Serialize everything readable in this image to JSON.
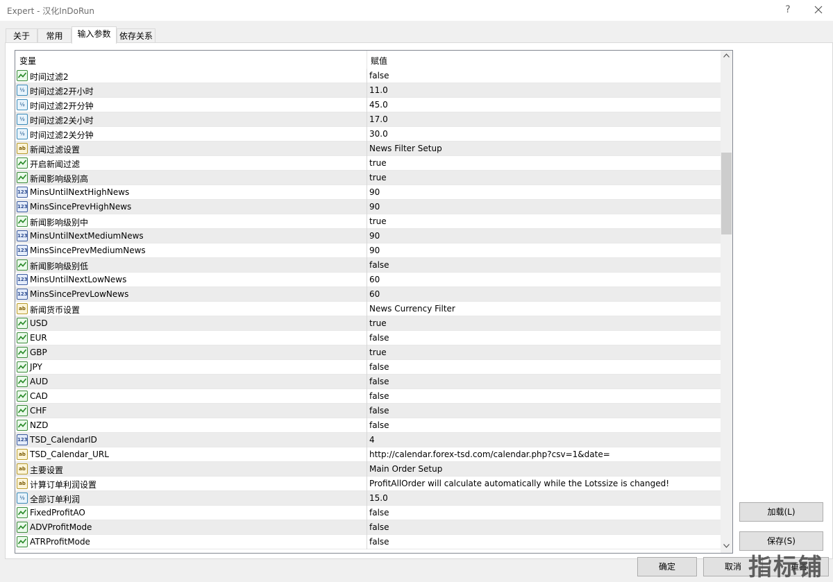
{
  "window": {
    "title": "Expert - 汉化InDoRun",
    "help_label": "?"
  },
  "tabs": [
    {
      "label": "关于"
    },
    {
      "label": "常用"
    },
    {
      "label": "输入参数"
    },
    {
      "label": "依存关系"
    }
  ],
  "grid": {
    "col_variable": "变量",
    "col_value": "赋值",
    "rows": [
      {
        "name": "时间过滤2",
        "value": "false",
        "type": "bool"
      },
      {
        "name": "时间过滤2开小时",
        "value": "11.0",
        "type": "dbl"
      },
      {
        "name": "时间过滤2开分钟",
        "value": "45.0",
        "type": "dbl"
      },
      {
        "name": "时间过滤2关小时",
        "value": "17.0",
        "type": "dbl"
      },
      {
        "name": "时间过滤2关分钟",
        "value": "30.0",
        "type": "dbl"
      },
      {
        "name": "新闻过滤设置",
        "value": "News Filter Setup",
        "type": "str"
      },
      {
        "name": "开启新闻过滤",
        "value": "true",
        "type": "bool"
      },
      {
        "name": "新闻影响级别高",
        "value": "true",
        "type": "bool"
      },
      {
        "name": "MinsUntilNextHighNews",
        "value": "90",
        "type": "int"
      },
      {
        "name": "MinsSincePrevHighNews",
        "value": "90",
        "type": "int"
      },
      {
        "name": "新闻影响级别中",
        "value": "true",
        "type": "bool"
      },
      {
        "name": "MinsUntilNextMediumNews",
        "value": "90",
        "type": "int"
      },
      {
        "name": "MinsSincePrevMediumNews",
        "value": "90",
        "type": "int"
      },
      {
        "name": "新闻影响级别低",
        "value": "false",
        "type": "bool"
      },
      {
        "name": "MinsUntilNextLowNews",
        "value": "60",
        "type": "int"
      },
      {
        "name": "MinsSincePrevLowNews",
        "value": "60",
        "type": "int"
      },
      {
        "name": "新闻货币设置",
        "value": "News Currency Filter",
        "type": "str"
      },
      {
        "name": "USD",
        "value": "true",
        "type": "bool"
      },
      {
        "name": "EUR",
        "value": "false",
        "type": "bool"
      },
      {
        "name": "GBP",
        "value": "true",
        "type": "bool"
      },
      {
        "name": "JPY",
        "value": "false",
        "type": "bool"
      },
      {
        "name": "AUD",
        "value": "false",
        "type": "bool"
      },
      {
        "name": "CAD",
        "value": "false",
        "type": "bool"
      },
      {
        "name": "CHF",
        "value": "false",
        "type": "bool"
      },
      {
        "name": "NZD",
        "value": "false",
        "type": "bool"
      },
      {
        "name": "TSD_CalendarID",
        "value": "4",
        "type": "int"
      },
      {
        "name": "TSD_Calendar_URL",
        "value": "http://calendar.forex-tsd.com/calendar.php?csv=1&date=",
        "type": "str"
      },
      {
        "name": "主要设置",
        "value": "Main Order Setup",
        "type": "str"
      },
      {
        "name": "计算订单利润设置",
        "value": " ProfitAllOrder will calculate automatically while the Lotssize is changed!",
        "type": "str"
      },
      {
        "name": "全部订单利润",
        "value": "15.0",
        "type": "dbl"
      },
      {
        "name": "FixedProfitAO",
        "value": "false",
        "type": "bool"
      },
      {
        "name": "ADVProfitMode",
        "value": "false",
        "type": "bool"
      },
      {
        "name": "ATRProfitMode",
        "value": "false",
        "type": "bool"
      }
    ]
  },
  "icons": {
    "bool": "boolean-icon",
    "dbl": "double-icon",
    "int": "integer-icon",
    "str": "string-icon"
  },
  "icon_glyphs": {
    "dbl": "½",
    "int": "123",
    "str": "ab"
  },
  "buttons": {
    "load": "加载(L)",
    "save": "保存(S)",
    "ok": "确定",
    "cancel": "取消",
    "reset": "重置"
  },
  "watermark": "指标铺"
}
